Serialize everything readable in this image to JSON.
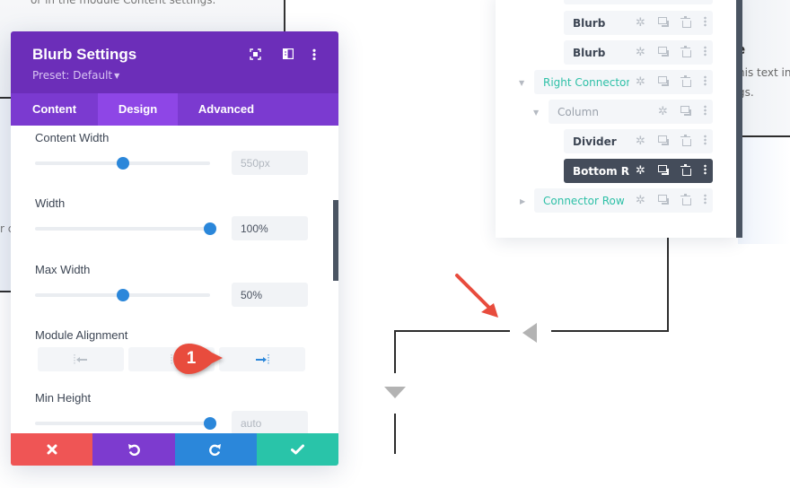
{
  "background": {
    "left_card_text": "or in the module Content settings.",
    "left_strip_text": "r c",
    "right_card_title": "e",
    "right_card_line1": "his text in",
    "right_card_line2": "gs."
  },
  "layers": {
    "items": [
      {
        "label": "Blurb",
        "style": "module",
        "icons": [
          "gear-icon",
          "duplicate-icon",
          "trash-icon",
          "more-icon"
        ]
      },
      {
        "label": "Blurb",
        "style": "module",
        "icons": [
          "gear-icon",
          "duplicate-icon",
          "trash-icon",
          "more-icon"
        ]
      },
      {
        "label": "Right Connector...",
        "style": "row",
        "expanded": true,
        "icons": [
          "gear-icon",
          "duplicate-icon",
          "trash-icon",
          "more-icon"
        ]
      },
      {
        "label": "Column",
        "style": "column",
        "expanded": true,
        "icons": [
          "gear-icon",
          "duplicate-icon",
          "more-icon"
        ]
      },
      {
        "label": "Divider",
        "style": "module",
        "icons": [
          "gear-icon",
          "duplicate-icon",
          "trash-icon",
          "more-icon"
        ]
      },
      {
        "label": "Bottom Ri...",
        "style": "active",
        "icons": [
          "gear-icon",
          "duplicate-icon",
          "trash-icon",
          "more-icon"
        ]
      },
      {
        "label": "Connector Row",
        "style": "row",
        "expanded": false,
        "icons": [
          "gear-icon",
          "duplicate-icon",
          "trash-icon",
          "more-icon"
        ]
      }
    ]
  },
  "modal": {
    "title": "Blurb Settings",
    "preset": "Preset: Default",
    "tabs": [
      {
        "label": "Content",
        "active": false
      },
      {
        "label": "Design",
        "active": true
      },
      {
        "label": "Advanced",
        "active": false
      }
    ],
    "fields": {
      "content_width": {
        "label": "Content Width",
        "value": "550px",
        "slider_percent": 50
      },
      "width": {
        "label": "Width",
        "value": "100%",
        "slider_percent": 100
      },
      "max_width": {
        "label": "Max Width",
        "value": "50%",
        "slider_percent": 50
      },
      "module_alignment": {
        "label": "Module Alignment",
        "options": [
          "left",
          "center",
          "right"
        ],
        "selected": "right"
      },
      "min_height": {
        "label": "Min Height",
        "value": "auto",
        "slider_percent": 100
      }
    },
    "footer": {
      "discard": "discard",
      "undo": "undo",
      "redo": "redo",
      "save": "save"
    }
  },
  "annotation": {
    "badge_number": "1",
    "badge_color": "#e84c3d"
  },
  "colors": {
    "header_purple": "#6c2eb9",
    "tab_purple": "#7b3ad0",
    "tab_active": "#8e46e6",
    "accent_blue": "#2b87da",
    "discard_red": "#ef5555",
    "save_teal": "#29c4a9",
    "teal_text": "#2ec0a7"
  }
}
